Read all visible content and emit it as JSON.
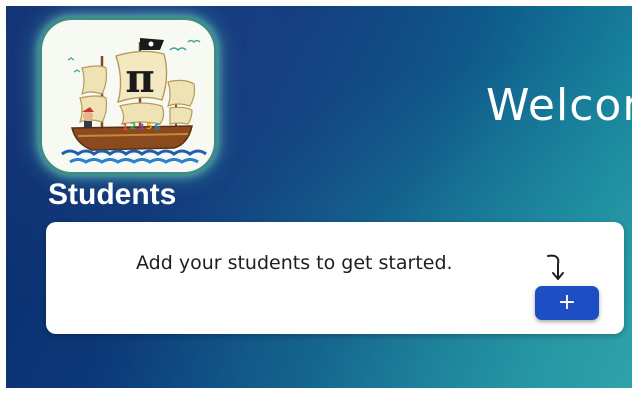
{
  "header": {
    "welcome_text": "Welcom"
  },
  "logo": {
    "icon": "pirate-ship-pi-logo",
    "symbol": "π"
  },
  "students": {
    "title": "Students",
    "empty_message": "Add your students to get started.",
    "add_button_label": "+",
    "hint_icon": "curved-arrow-down-icon"
  },
  "colors": {
    "background_dark": "#0a2a6a",
    "background_teal": "#2aa0a8",
    "button_blue": "#1e4ec4",
    "logo_glow": "#7be0c8"
  }
}
